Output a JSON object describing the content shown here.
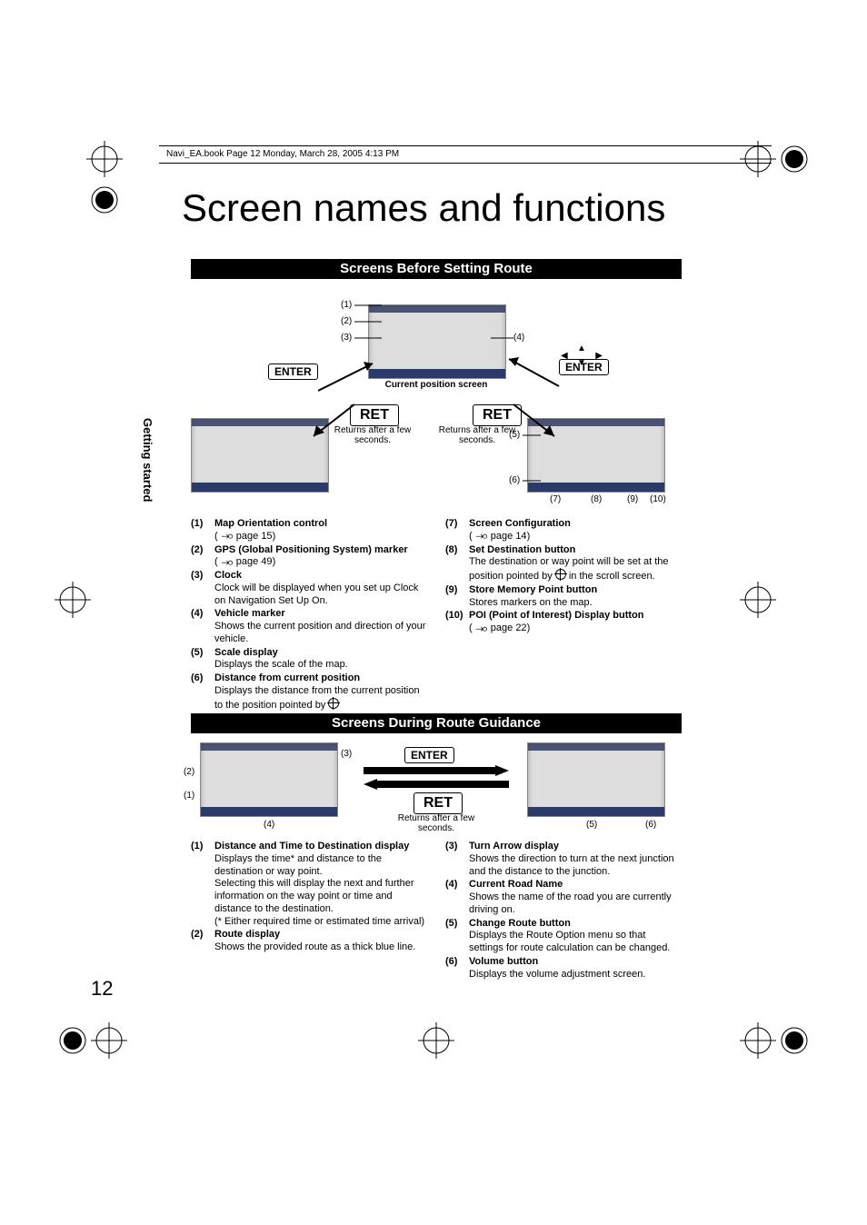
{
  "header": "Navi_EA.book  Page 12  Monday, March 28, 2005  4:13 PM",
  "side_tab": "Getting started",
  "title": "Screen names and functions",
  "page_number": "12",
  "keys": {
    "enter": "ENTER",
    "ret": "RET"
  },
  "notes": {
    "returns": "Returns after a\nfew seconds.",
    "current_pos": "Current position screen"
  },
  "section1": {
    "heading": "Screens Before Setting Route",
    "callouts": [
      "(1)",
      "(2)",
      "(3)",
      "(4)",
      "(5)",
      "(6)",
      "(7)",
      "(8)",
      "(9)",
      "(10)"
    ],
    "left": [
      {
        "n": "(1)",
        "t": "Map Orientation control",
        "d": "",
        "ref": "page 15"
      },
      {
        "n": "(2)",
        "t": "GPS (Global Positioning System) marker",
        "d": "",
        "ref": "page 49"
      },
      {
        "n": "(3)",
        "t": "Clock",
        "d": "Clock will be displayed when you set up Clock on Navigation Set Up On."
      },
      {
        "n": "(4)",
        "t": "Vehicle marker",
        "d": "Shows the current position and direction of your vehicle."
      },
      {
        "n": "(5)",
        "t": "Scale display",
        "d": "Displays the scale of the map."
      },
      {
        "n": "(6)",
        "t": "Distance from current position",
        "d": "Displays the distance from the current position to the position pointed by ",
        "aim": true
      }
    ],
    "right": [
      {
        "n": "(7)",
        "t": "Screen Configuration",
        "d": "",
        "ref": "page 14"
      },
      {
        "n": "(8)",
        "t": "Set Destination button",
        "d": "The destination or way point will be set at the position pointed by ",
        "aim": true,
        "d2": " in the scroll screen."
      },
      {
        "n": "(9)",
        "t": "Store Memory Point button",
        "d": "Stores markers on the map."
      },
      {
        "n": "(10)",
        "t": "POI (Point of Interest) Display button",
        "d": "",
        "ref": "page 22"
      }
    ]
  },
  "section2": {
    "heading": "Screens During Route Guidance",
    "callouts": [
      "(1)",
      "(2)",
      "(3)",
      "(4)",
      "(5)",
      "(6)"
    ],
    "left": [
      {
        "n": "(1)",
        "t": "Distance and Time to Destination display",
        "d": "Displays the time* and distance to the destination or way point.\nSelecting this will display the next and further information on the way point or time and distance to the destination.\n(* Either required time or estimated time arrival)"
      },
      {
        "n": "(2)",
        "t": "Route display",
        "d": "Shows the provided route as a thick blue line."
      }
    ],
    "right": [
      {
        "n": "(3)",
        "t": "Turn Arrow display",
        "d": "Shows the direction to turn at the next junction and the distance to the junction."
      },
      {
        "n": "(4)",
        "t": "Current Road Name",
        "d": "Shows the name of the road you are currently driving on."
      },
      {
        "n": "(5)",
        "t": "Change Route button",
        "d": "Displays the Route Option menu so that settings for route calculation can be changed."
      },
      {
        "n": "(6)",
        "t": "Volume button",
        "d": "Displays the volume adjustment screen."
      }
    ]
  }
}
